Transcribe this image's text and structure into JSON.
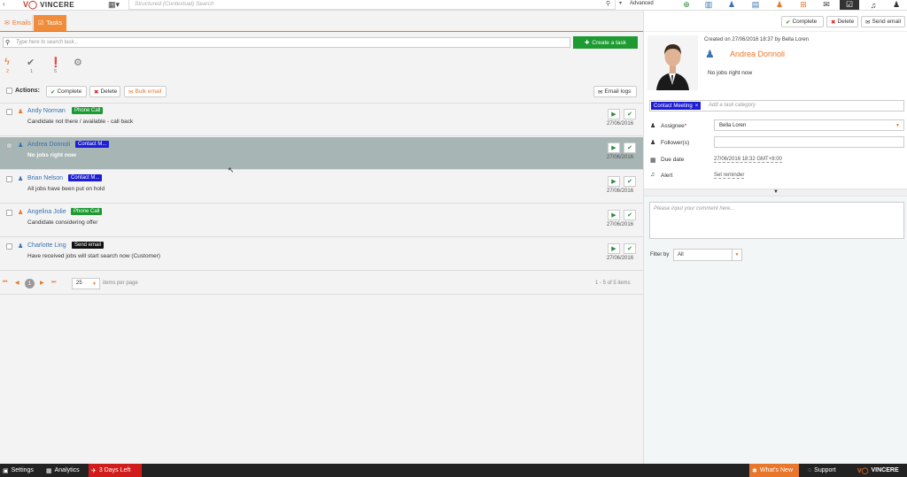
{
  "app": {
    "logo": "VINCERE",
    "search_placeholder": "Structured (Contextual) Search",
    "advanced": "Advanced"
  },
  "tabs": [
    {
      "label": "Emails"
    },
    {
      "label": "Tasks"
    }
  ],
  "task_search_placeholder": "Type here to search task...",
  "create_task": "Create a task",
  "filter_counts": [
    "2",
    "1",
    "5"
  ],
  "actions": {
    "label": "Actions:",
    "complete": "Complete",
    "delete": "Delete",
    "bulk_email": "Bulk email",
    "email_logs": "Email logs"
  },
  "tasks": [
    {
      "name": "Andy Norman",
      "badge": "Phone Call",
      "badge_color": "#1e9a32",
      "desc": "Candidate not there / available - call back",
      "date": "27/06/2016",
      "person_color": "#e8762b"
    },
    {
      "name": "Andrea Donnoli",
      "badge": "Contact M...",
      "badge_color": "#1d1dd6",
      "desc": "No jobs right now",
      "date": "27/06/2016",
      "person_color": "#3572b0"
    },
    {
      "name": "Brian Nelson",
      "badge": "Contact M...",
      "badge_color": "#1d1dd6",
      "desc": "All jobs have been put on hold",
      "date": "27/06/2016",
      "person_color": "#3572b0"
    },
    {
      "name": "Angelina Jolie",
      "badge": "Phone Call",
      "badge_color": "#1e9a32",
      "desc": "Candidate considering offer",
      "date": "27/06/2016",
      "person_color": "#e8762b"
    },
    {
      "name": "Charlotte Ling",
      "badge": "Send email",
      "badge_color": "#111111",
      "desc": "Have received jobs will start search now (Customer)",
      "date": "27/06/2016",
      "person_color": "#3572b0"
    }
  ],
  "pagination": {
    "page": "1",
    "per_page": "25",
    "per_page_label": "items per page",
    "summary": "1 - 5 of 5 items"
  },
  "detail": {
    "complete": "Complete",
    "delete": "Delete",
    "send_email": "Send email",
    "created": "Created on 27/06/2016 18:37 by Bella Loren",
    "contact_name": "Andrea Donnoli",
    "note": "No jobs right now",
    "category_tag": "Contact Meeting",
    "category_placeholder": "Add a task category",
    "assignee_label": "Assignee",
    "assignee_value": "Bella Loren",
    "followers_label": "Follower(s)",
    "due_label": "Due date",
    "due_value": "27/06/2016 18:32 GMT+8:00",
    "alert_label": "Alert",
    "alert_value": "Set reminder",
    "comment_placeholder": "Please input your comment here...",
    "filter_label": "Filter by",
    "filter_value": "All"
  },
  "bottom": {
    "settings": "Settings",
    "analytics": "Analytics",
    "trial": "3 Days Left",
    "whats_new": "What's New",
    "support": "Support",
    "logo": "VINCERE"
  },
  "colors": {
    "accent": "#e8762b",
    "selected_row": "#a7b6b4",
    "green": "#1e9a32",
    "link": "#3572b0"
  }
}
